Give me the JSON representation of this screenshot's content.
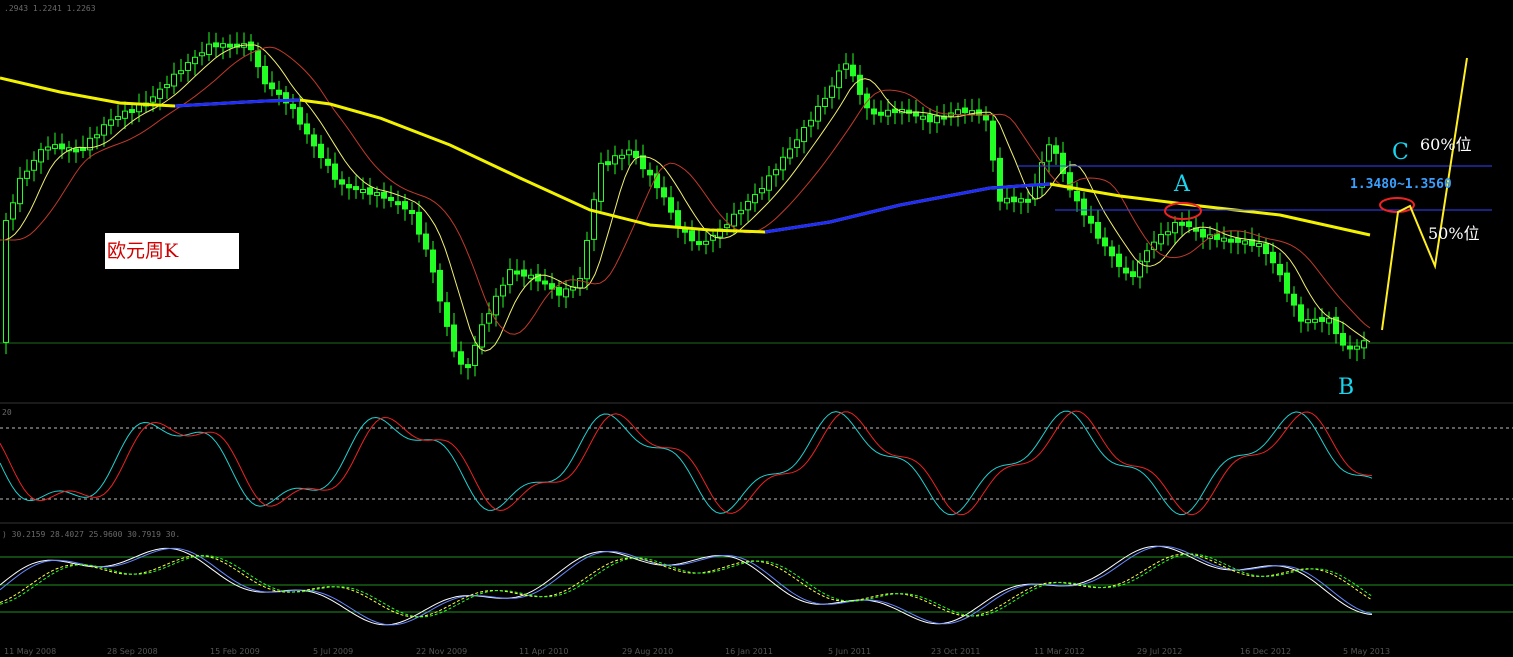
{
  "chart_data": {
    "type": "candlestick",
    "title": "欧元周K",
    "annotations": {
      "point_a": "A",
      "point_b": "B",
      "point_c": "C",
      "target_range": "1.3480~1.3560",
      "fib_60": "60%位",
      "fib_50": "50%位"
    },
    "panel_headers": {
      "main": ".2943 1.2241 1.2263",
      "stoch_level": "20",
      "lower": ") 30.2159 28.4027 25.9600 30.7919 30."
    },
    "x_labels": [
      "11 May 2008",
      "28 Sep 2008",
      "15 Feb 2009",
      "5 Jul 2009",
      "22 Nov 2009",
      "11 Apr 2010",
      "29 Aug 2010",
      "16 Jan 2011",
      "5 Jun 2011",
      "23 Oct 2011",
      "11 Mar 2012",
      "29 Jul 2012",
      "16 Dec 2012",
      "5 May 2013"
    ],
    "colors": {
      "candle": "#22ff22",
      "ma_short": "#f0f070",
      "ma_mid": "#c03a2a",
      "ma_long": "#f2f200",
      "ma_long_flat": "#1f2cff",
      "stoch_k": "#20d0d0",
      "stoch_d": "#ee2222",
      "projection": "#ffee22",
      "fib_line": "#3344ff",
      "ellipse": "#ee2222"
    }
  }
}
